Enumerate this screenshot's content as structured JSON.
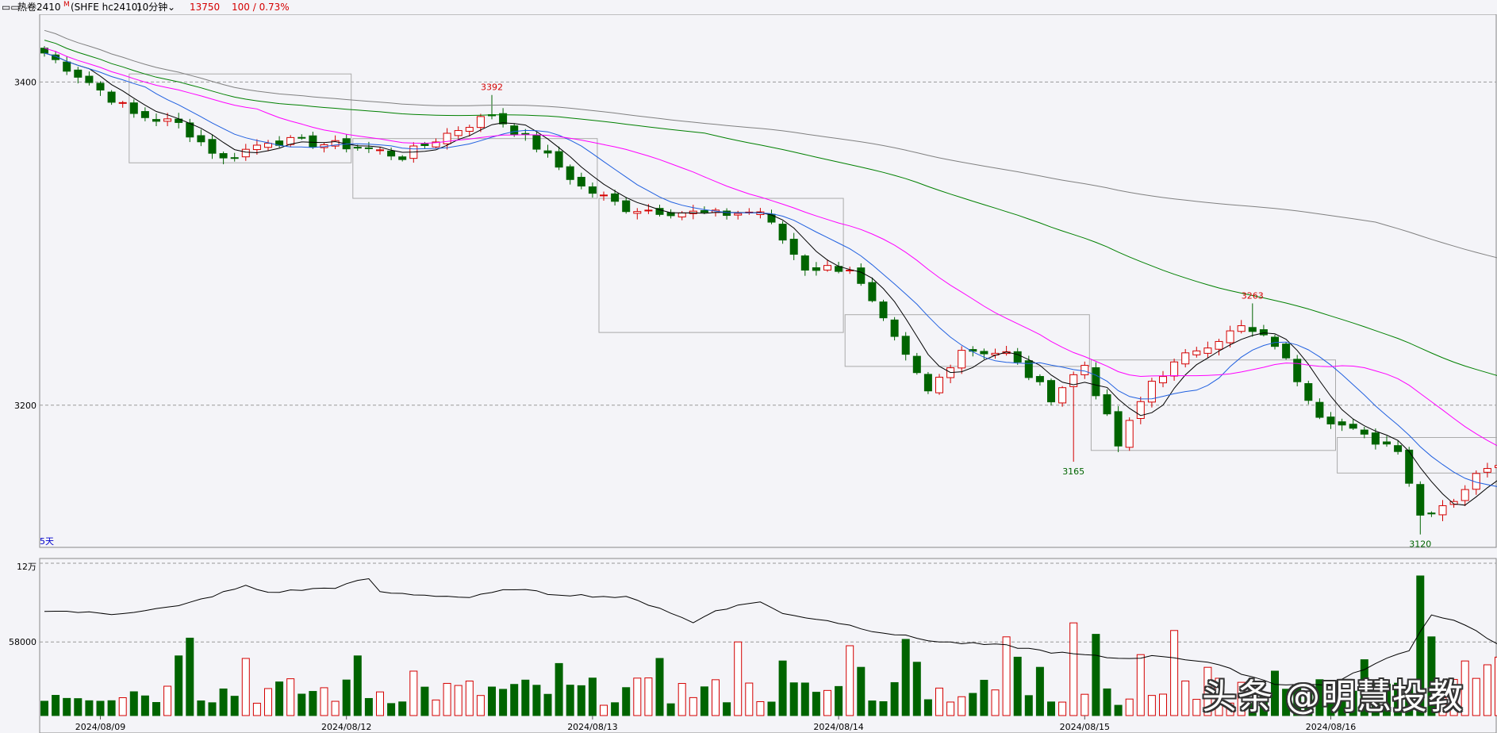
{
  "header": {
    "glyph": "▭▭",
    "symbol": "热卷2410",
    "marker": "M",
    "code": "(SHFE hc2410)",
    "period": "10分钟",
    "chevron": "⌄",
    "price": "13750",
    "change": "100 / 0.73%"
  },
  "watermark": "头条 @明慧投教",
  "colors": {
    "up": "#d40000",
    "down": "#006400",
    "ma5": "#000000",
    "ma10": "#2060e0",
    "ma20": "#ff00ff",
    "ma60": "#008000",
    "ma120": "#808080"
  },
  "chart_data": [
    {
      "type": "candlestick",
      "x_ticks": [
        "2024/08/09",
        "2024/08/12",
        "2024/08/13",
        "2024/08/14",
        "2024/08/15",
        "2024/08/16"
      ],
      "y_ticks": [
        3400,
        3200
      ],
      "ylim": [
        3112,
        3438
      ],
      "mode_label": "5天",
      "annotations": [
        {
          "text": "3392",
          "value": 3392,
          "bar": 40
        },
        {
          "text": "3165",
          "value": 3165,
          "bar": 92
        },
        {
          "text": "3263",
          "value": 3263,
          "bar": 108
        },
        {
          "text": "3120",
          "value": 3120,
          "bar": 123
        }
      ],
      "close_waypoints": [
        [
          0,
          3418
        ],
        [
          4,
          3400
        ],
        [
          8,
          3380
        ],
        [
          12,
          3374
        ],
        [
          16,
          3352
        ],
        [
          20,
          3364
        ],
        [
          24,
          3362
        ],
        [
          28,
          3360
        ],
        [
          32,
          3354
        ],
        [
          36,
          3368
        ],
        [
          40,
          3380
        ],
        [
          44,
          3360
        ],
        [
          48,
          3335
        ],
        [
          52,
          3322
        ],
        [
          56,
          3320
        ],
        [
          60,
          3318
        ],
        [
          64,
          3320
        ],
        [
          68,
          3285
        ],
        [
          72,
          3285
        ],
        [
          76,
          3240
        ],
        [
          79,
          3208
        ],
        [
          82,
          3235
        ],
        [
          86,
          3232
        ],
        [
          90,
          3205
        ],
        [
          93,
          3225
        ],
        [
          96,
          3175
        ],
        [
          99,
          3215
        ],
        [
          103,
          3235
        ],
        [
          107,
          3248
        ],
        [
          110,
          3238
        ],
        [
          114,
          3195
        ],
        [
          118,
          3180
        ],
        [
          121,
          3174
        ],
        [
          123,
          3132
        ],
        [
          126,
          3142
        ],
        [
          129,
          3163
        ],
        [
          132,
          3168
        ]
      ],
      "highlights": [
        {
          "from": 8,
          "to": 27,
          "low": 3350,
          "high": 3405
        },
        {
          "from": 28,
          "to": 49,
          "low": 3328,
          "high": 3365
        },
        {
          "from": 50,
          "to": 71,
          "low": 3245,
          "high": 3328
        },
        {
          "from": 72,
          "to": 93,
          "low": 3224,
          "high": 3256
        },
        {
          "from": 94,
          "to": 115,
          "low": 3172,
          "high": 3228
        },
        {
          "from": 116,
          "to": 132,
          "low": 3158,
          "high": 3180
        }
      ]
    },
    {
      "type": "bar",
      "y_ticks_label": [
        "12万",
        "58000"
      ],
      "y_ticks_value": [
        120000,
        58000
      ],
      "ylim": [
        0,
        120000
      ],
      "spike_bars": [
        [
          12,
          47000
        ],
        [
          13,
          61000
        ],
        [
          18,
          45000
        ],
        [
          28,
          47000
        ],
        [
          33,
          35000
        ],
        [
          46,
          41000
        ],
        [
          55,
          45000
        ],
        [
          62,
          58000
        ],
        [
          66,
          43000
        ],
        [
          72,
          55000
        ],
        [
          73,
          38000
        ],
        [
          77,
          60000
        ],
        [
          78,
          42000
        ],
        [
          86,
          62000
        ],
        [
          87,
          46000
        ],
        [
          89,
          38000
        ],
        [
          92,
          73000
        ],
        [
          94,
          64000
        ],
        [
          98,
          48000
        ],
        [
          101,
          67000
        ],
        [
          104,
          38000
        ],
        [
          110,
          35000
        ],
        [
          118,
          44000
        ],
        [
          123,
          110000
        ],
        [
          124,
          62000
        ],
        [
          127,
          43000
        ],
        [
          129,
          40000
        ],
        [
          130,
          46000
        ],
        [
          131,
          54000
        ]
      ],
      "oi_waypoints": [
        [
          0,
          83000
        ],
        [
          6,
          80000
        ],
        [
          12,
          86000
        ],
        [
          16,
          97000
        ],
        [
          18,
          102000
        ],
        [
          20,
          97000
        ],
        [
          26,
          101000
        ],
        [
          29,
          108000
        ],
        [
          30,
          97000
        ],
        [
          38,
          93000
        ],
        [
          42,
          100000
        ],
        [
          45,
          96000
        ],
        [
          52,
          93000
        ],
        [
          55,
          85000
        ],
        [
          58,
          73000
        ],
        [
          60,
          83000
        ],
        [
          64,
          90000
        ],
        [
          66,
          80000
        ],
        [
          70,
          75000
        ],
        [
          74,
          67000
        ],
        [
          80,
          58000
        ],
        [
          86,
          55000
        ],
        [
          90,
          50000
        ],
        [
          96,
          45000
        ],
        [
          100,
          47000
        ],
        [
          104,
          42000
        ],
        [
          110,
          25000
        ],
        [
          115,
          24000
        ],
        [
          118,
          37000
        ],
        [
          122,
          52000
        ],
        [
          124,
          80000
        ],
        [
          127,
          72000
        ],
        [
          130,
          55000
        ],
        [
          132,
          48000
        ]
      ]
    }
  ]
}
